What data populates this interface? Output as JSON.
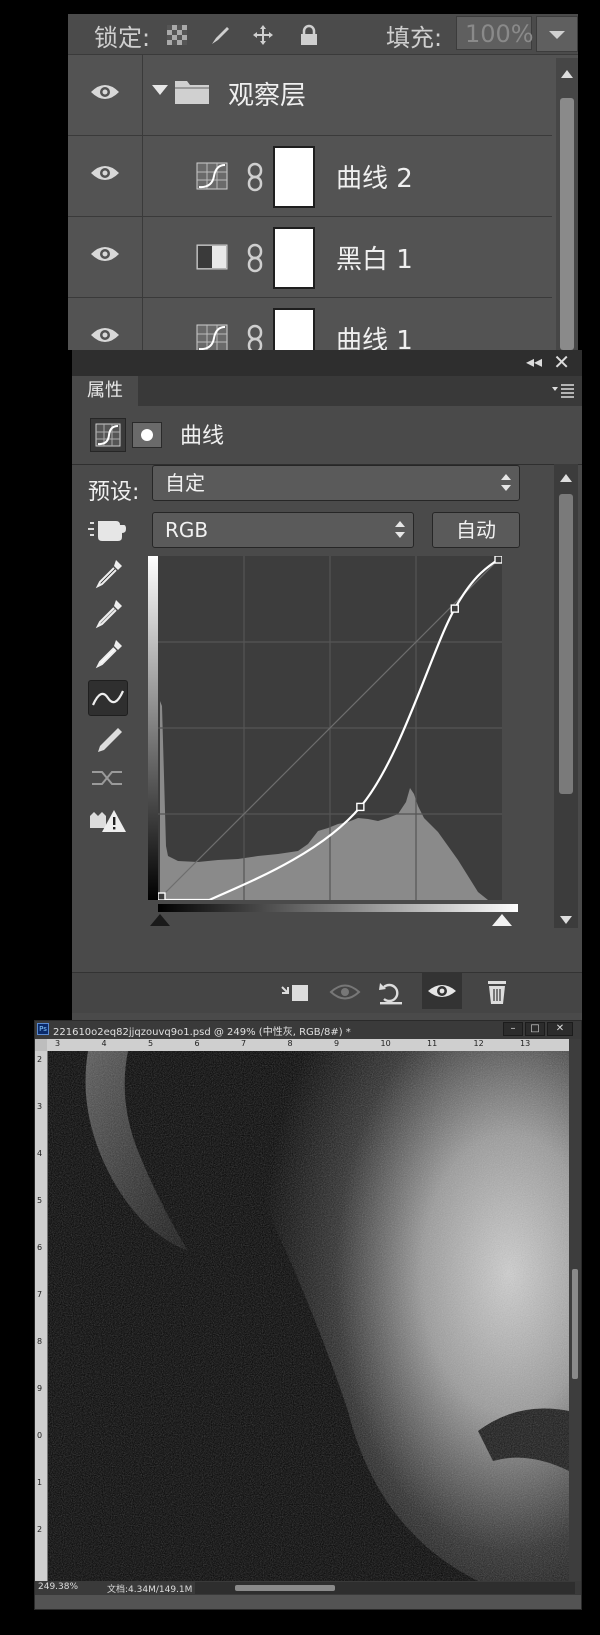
{
  "layers_panel": {
    "lock_label": "锁定:",
    "fill_label": "填充:",
    "fill_value": "100%",
    "lock_icons": [
      "lock-transparent-pixels-icon",
      "lock-image-pixels-icon",
      "lock-position-icon",
      "lock-all-icon"
    ],
    "group": {
      "name": "观察层",
      "expanded": true
    },
    "layers": [
      {
        "name": "曲线 2",
        "type": "curves",
        "adjustment_icon": "curves-adjustment-icon"
      },
      {
        "name": "黑白 1",
        "type": "black-white",
        "adjustment_icon": "black-white-adjustment-icon"
      },
      {
        "name": "曲线 1",
        "type": "curves",
        "adjustment_icon": "curves-adjustment-icon"
      }
    ]
  },
  "properties_panel": {
    "tab_label": "属性",
    "title": "曲线",
    "preset_label": "预设:",
    "preset_value": "自定",
    "channel_value": "RGB",
    "auto_label": "自动",
    "tools": [
      "sample-black-point-icon",
      "sample-gray-point-icon",
      "sample-white-point-icon",
      "curve-edit-points-icon",
      "pencil-draw-icon",
      "smooth-curve-icon",
      "clipping-warning-icon"
    ],
    "curve_points": [
      [
        0,
        0
      ],
      [
        38,
        0
      ],
      [
        150,
        69
      ],
      [
        220,
        216
      ],
      [
        255,
        255
      ]
    ],
    "footer_buttons": [
      "clip-to-layer-icon",
      "view-previous-state-icon",
      "reset-icon",
      "toggle-visibility-icon",
      "delete-icon"
    ]
  },
  "document_window": {
    "title": "221610o2eq82jjqzouvq9o1.psd @ 249% (中性灰, RGB/8#) *",
    "zoom": "249.38%",
    "doc_info": "文档:4.34M/149.1M",
    "ruler_top_ticks": [
      "3",
      "4",
      "5",
      "6",
      "7",
      "8",
      "9",
      "10",
      "11",
      "12",
      "13"
    ],
    "ruler_left_ticks": [
      "2",
      "3",
      "4",
      "5",
      "6",
      "7",
      "8",
      "9",
      "0",
      "1",
      "2"
    ],
    "window_buttons": [
      "minimize-icon",
      "maximize-icon",
      "close-icon"
    ]
  },
  "colors": {
    "panel_bg": "#535353",
    "panel_dark": "#4a4a4a",
    "curve": "#ffffff",
    "histogram": "#8a8a8a"
  }
}
